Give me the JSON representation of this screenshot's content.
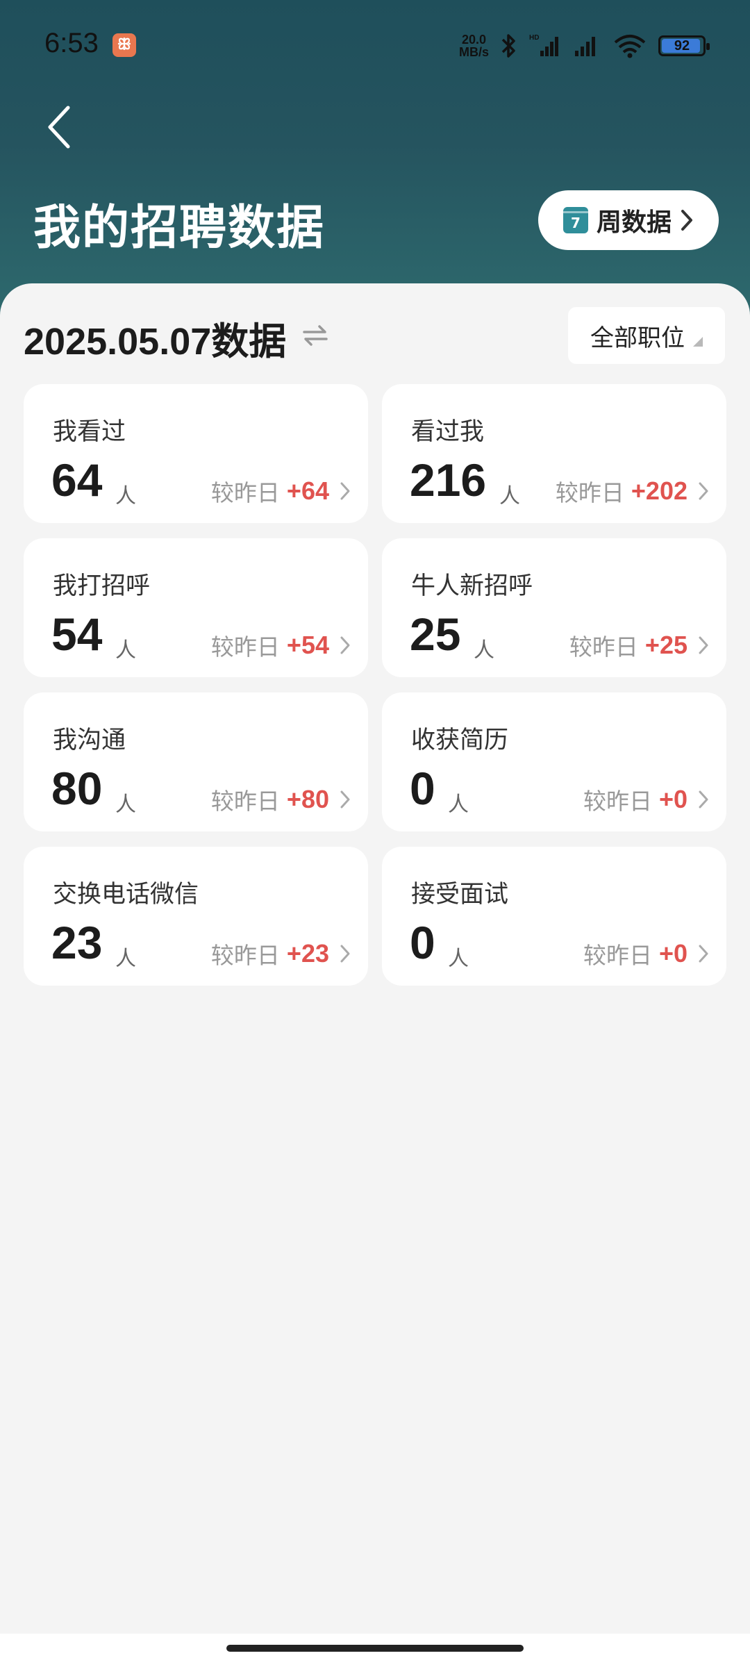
{
  "status_bar": {
    "time": "6:53",
    "app_icon": "app-notification-icon",
    "net_speed_top": "20.0",
    "net_speed_bottom": "MB/s",
    "battery": "92"
  },
  "header": {
    "title": "我的招聘数据",
    "week_button_label": "周数据",
    "calendar_day": "7"
  },
  "toolbar": {
    "date_title": "2025.05.07数据",
    "position_filter": "全部职位"
  },
  "compare_label": "较昨日",
  "unit": "人",
  "cards": [
    {
      "label": "我看过",
      "value": "64",
      "delta": "+64"
    },
    {
      "label": "看过我",
      "value": "216",
      "delta": "+202"
    },
    {
      "label": "我打招呼",
      "value": "54",
      "delta": "+54"
    },
    {
      "label": "牛人新招呼",
      "value": "25",
      "delta": "+25"
    },
    {
      "label": "我沟通",
      "value": "80",
      "delta": "+80"
    },
    {
      "label": "收获简历",
      "value": "0",
      "delta": "+0"
    },
    {
      "label": "交换电话微信",
      "value": "23",
      "delta": "+23"
    },
    {
      "label": "接受面试",
      "value": "0",
      "delta": "+0"
    }
  ],
  "colors": {
    "header": "#25545f",
    "accent_delta": "#e0534f",
    "calendar_icon": "#2f8e9a"
  }
}
